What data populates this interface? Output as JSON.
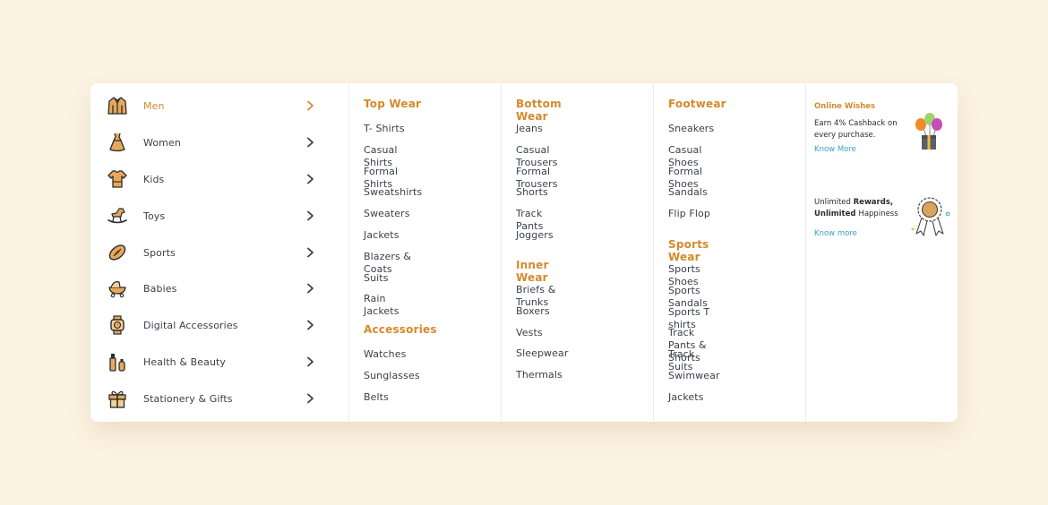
{
  "sidebar": {
    "items": [
      {
        "label": "Men",
        "icon": "jacket-icon"
      },
      {
        "label": "Women",
        "icon": "dress-icon"
      },
      {
        "label": "Kids",
        "icon": "kids-shirt-icon"
      },
      {
        "label": "Toys",
        "icon": "rocking-horse-icon"
      },
      {
        "label": "Sports",
        "icon": "football-icon"
      },
      {
        "label": "Babies",
        "icon": "stroller-icon"
      },
      {
        "label": "Digital Accessories",
        "icon": "smartwatch-icon"
      },
      {
        "label": "Health & Beauty",
        "icon": "cosmetics-icon"
      },
      {
        "label": "Stationery & Gifts",
        "icon": "gift-icon"
      }
    ],
    "active_index": 0
  },
  "columns": {
    "top_wear": {
      "title": "Top Wear",
      "items": [
        "T- Shirts",
        "Casual Shirts",
        "Formal Shirts",
        "Sweatshirts",
        "Sweaters",
        "Jackets",
        "Blazers & Coats",
        "Suits",
        "Rain Jackets"
      ]
    },
    "accessories": {
      "title": "Accessories",
      "items": [
        "Watches",
        "Sunglasses",
        "Belts"
      ]
    },
    "bottom_wear": {
      "title": "Bottom Wear",
      "items": [
        "Jeans",
        "Casual Trousers",
        "Formal Trousers",
        "Shorts",
        "Track Pants",
        "Joggers"
      ]
    },
    "inner_wear": {
      "title": "Inner Wear",
      "items": [
        "Briefs & Trunks",
        "Boxers",
        "Vests",
        "Sleepwear",
        "Thermals"
      ]
    },
    "footwear": {
      "title": "Footwear",
      "items": [
        "Sneakers",
        "Casual Shoes",
        "Formal Shoes",
        "Sandals",
        "Flip Flop"
      ]
    },
    "sports_wear": {
      "title": "Sports Wear",
      "items": [
        "Sports Shoes",
        "Sports Sandals",
        "Sports T shirts",
        "Track Pants & Shorts",
        "Track Suits",
        "Swimwear",
        "Jackets"
      ]
    }
  },
  "promos": {
    "wishes": {
      "title": "Online Wishes",
      "line1": "Earn 4% Cashback on",
      "line2": "every purchase.",
      "link": "Know More",
      "icon": "balloons-gift-icon"
    },
    "rewards": {
      "line1_a": "Unlimited ",
      "line1_b": "Rewards,",
      "line2_a": "Unlimited ",
      "line2_b": "Happiness",
      "link": "Know more",
      "icon": "award-ribbon-icon"
    }
  },
  "colors": {
    "accent": "#d58a2c",
    "text": "#3a3f4a",
    "link": "#3aa0c9",
    "background": "#fdf3e3",
    "icon_fill": "#e8a85a",
    "icon_stroke": "#2b2b2b"
  }
}
